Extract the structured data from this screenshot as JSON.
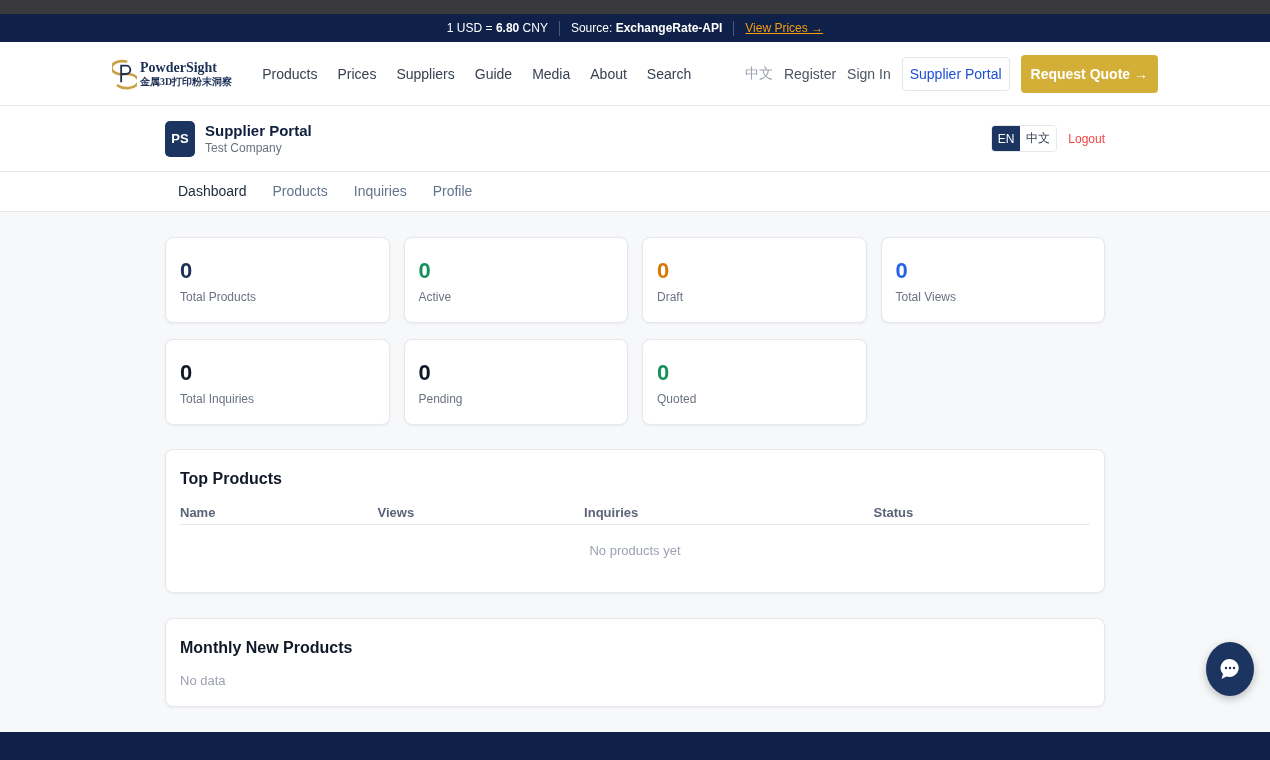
{
  "rate_bar": {
    "rate": "1 USD = **6.80** CNY",
    "source": "Source: **ExchangeRate-API**",
    "link": "View Prices →"
  },
  "header": {
    "logo": {
      "name": "PowderSight",
      "tagline": "金属3D打印粉末洞察"
    },
    "nav": [
      "Products",
      "Prices",
      "Suppliers",
      "Guide",
      "Media",
      "About",
      "Search"
    ],
    "language": "中文",
    "register": "Register",
    "sign_in": "Sign In",
    "portal_button": "Supplier Portal",
    "quote_button": "Request Quote →"
  },
  "portal": {
    "avatar": "PS",
    "title": "Supplier Portal",
    "company": "Test Company",
    "languages": [
      {
        "label": "EN",
        "selected": true
      },
      {
        "label": "中文",
        "selected": false
      }
    ],
    "logout": "Logout",
    "tabs": [
      {
        "label": "Dashboard",
        "selected": true
      },
      {
        "label": "Products",
        "selected": false
      },
      {
        "label": "Inquiries",
        "selected": false
      },
      {
        "label": "Profile",
        "selected": false
      }
    ]
  },
  "stats": [
    {
      "value": "0",
      "label": "Total Products",
      "color": "#1c2f55"
    },
    {
      "value": "0",
      "label": "Active",
      "color": "#16915e"
    },
    {
      "value": "0",
      "label": "Draft",
      "color": "#d97706"
    },
    {
      "value": "0",
      "label": "Total Views",
      "color": "#2563eb"
    },
    {
      "value": "0",
      "label": "Total Inquiries",
      "color": "#111827"
    },
    {
      "value": "0",
      "label": "Pending",
      "color": "#111827"
    },
    {
      "value": "0",
      "label": "Quoted",
      "color": "#16915e"
    }
  ],
  "top_products": {
    "title": "Top Products",
    "columns": [
      "Name",
      "Views",
      "Inquiries",
      "Status"
    ],
    "empty": "No products yet"
  },
  "monthly": {
    "title": "Monthly New Products",
    "empty": "No data"
  }
}
